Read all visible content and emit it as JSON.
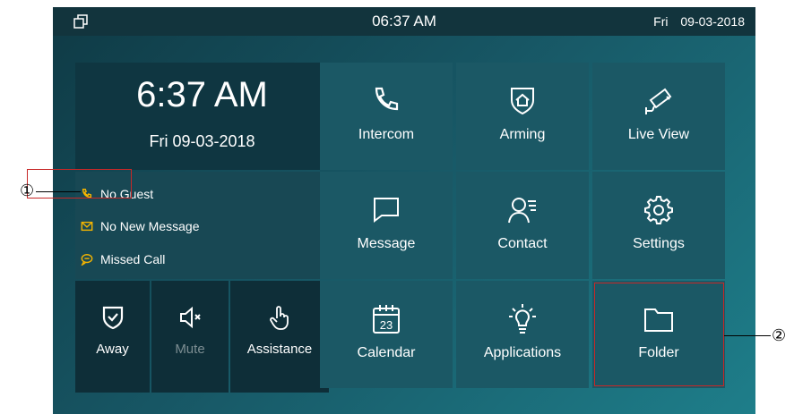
{
  "status_bar": {
    "time": "06:37 AM",
    "date": "Fri   09-03-2018"
  },
  "clock": {
    "time": "6:37 AM",
    "date": "Fri 09-03-2018"
  },
  "notifications": [
    {
      "icon": "phone-icon",
      "label": "No Guest",
      "color": "#f5b400"
    },
    {
      "icon": "envelope-icon",
      "label": "No New Message",
      "color": "#f5b400"
    },
    {
      "icon": "chat-bubble-icon",
      "label": "Missed Call",
      "color": "#f5b400"
    }
  ],
  "quick_buttons": [
    {
      "icon": "shield-check-icon",
      "label": "Away"
    },
    {
      "icon": "speaker-mute-icon",
      "label": "Mute",
      "disabled": true
    },
    {
      "icon": "hand-pointer-icon",
      "label": "Assistance"
    }
  ],
  "tiles": [
    {
      "icon": "phone-icon",
      "label": "Intercom"
    },
    {
      "icon": "shield-home-icon",
      "label": "Arming"
    },
    {
      "icon": "cctv-camera-icon",
      "label": "Live View"
    },
    {
      "icon": "message-bubble-icon",
      "label": "Message"
    },
    {
      "icon": "contact-person-icon",
      "label": "Contact"
    },
    {
      "icon": "gear-icon",
      "label": "Settings"
    },
    {
      "icon": "calendar-icon",
      "label": "Calendar",
      "day": "23"
    },
    {
      "icon": "lightbulb-icon",
      "label": "Applications"
    },
    {
      "icon": "folder-icon",
      "label": "Folder"
    }
  ],
  "callouts": [
    "①",
    "②"
  ],
  "colors": {
    "accent_notification": "#f5b400",
    "highlight_box": "#c62828",
    "tile_bg": "#1b5865"
  }
}
